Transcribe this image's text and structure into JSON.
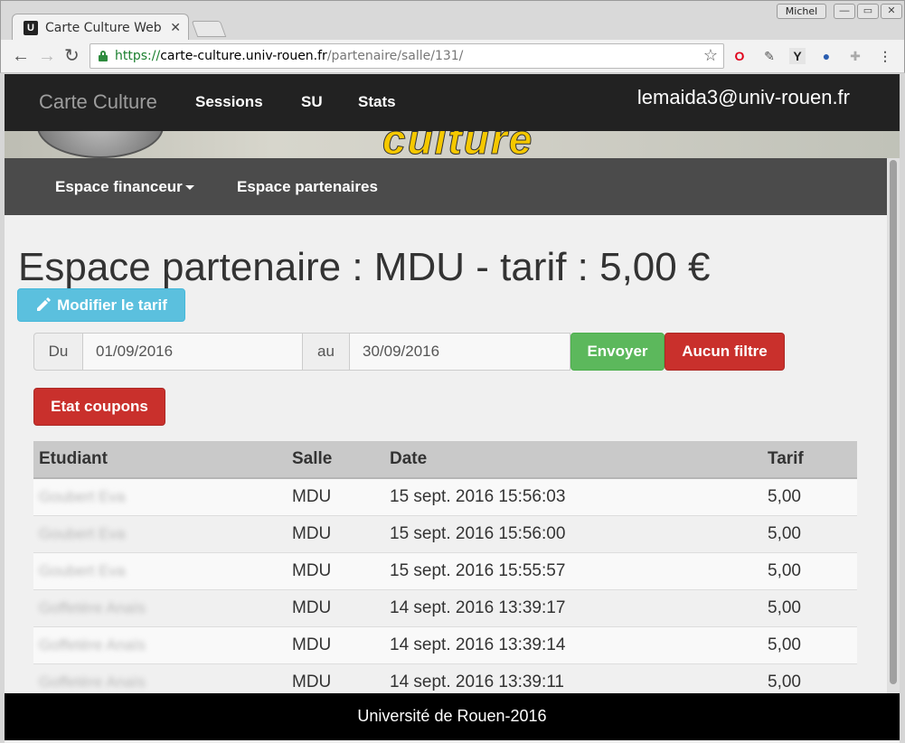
{
  "browser": {
    "tab_title": "Carte Culture Web",
    "tab_favicon": "U",
    "profile": "Michel",
    "url_scheme": "https://",
    "url_host": "carte-culture.univ-rouen.fr",
    "url_path": "/partenaire/salle/131/"
  },
  "navbar": {
    "brand": "Carte Culture",
    "links": [
      "Sessions",
      "SU",
      "Stats"
    ],
    "user": "lemaida3@univ-rouen.fr"
  },
  "subnav": {
    "financeur": "Espace financeur",
    "partenaires": "Espace partenaires"
  },
  "main": {
    "title": "Espace partenaire : MDU - tarif : 5,00 €",
    "edit_button": "Modifier le tarif",
    "filter": {
      "from_label": "Du",
      "from_value": "01/09/2016",
      "to_label": "au",
      "to_value": "30/09/2016",
      "submit": "Envoyer",
      "clear": "Aucun filtre"
    },
    "coupons_button": "Etat coupons"
  },
  "table": {
    "headers": [
      "Etudiant",
      "Salle",
      "Date",
      "Tarif"
    ],
    "rows": [
      {
        "etudiant": "Goubert Eva",
        "salle": "MDU",
        "date": "15 sept. 2016 15:56:03",
        "tarif": "5,00"
      },
      {
        "etudiant": "Goubert Eva",
        "salle": "MDU",
        "date": "15 sept. 2016 15:56:00",
        "tarif": "5,00"
      },
      {
        "etudiant": "Goubert Eva",
        "salle": "MDU",
        "date": "15 sept. 2016 15:55:57",
        "tarif": "5,00"
      },
      {
        "etudiant": "Goffetère Anaïs",
        "salle": "MDU",
        "date": "14 sept. 2016 13:39:17",
        "tarif": "5,00"
      },
      {
        "etudiant": "Goffetère Anaïs",
        "salle": "MDU",
        "date": "14 sept. 2016 13:39:14",
        "tarif": "5,00"
      },
      {
        "etudiant": "Goffetère Anaïs",
        "salle": "MDU",
        "date": "14 sept. 2016 13:39:11",
        "tarif": "5,00"
      }
    ]
  },
  "footer": {
    "text": "Université de Rouen-2016"
  },
  "colors": {
    "navbar": "#222222",
    "subnav": "#4b4b4b",
    "info": "#5bc0de",
    "success": "#5cb85c",
    "danger": "#c9302c"
  }
}
